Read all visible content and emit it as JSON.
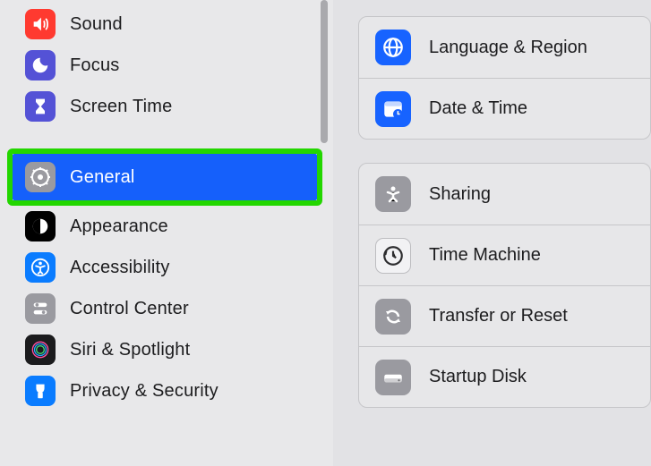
{
  "sidebar": {
    "items": [
      {
        "label": "Sound"
      },
      {
        "label": "Focus"
      },
      {
        "label": "Screen Time"
      },
      {
        "label": "General"
      },
      {
        "label": "Appearance"
      },
      {
        "label": "Accessibility"
      },
      {
        "label": "Control Center"
      },
      {
        "label": "Siri & Spotlight"
      },
      {
        "label": "Privacy & Security"
      }
    ]
  },
  "panel": {
    "group1": [
      {
        "label": "Language & Region"
      },
      {
        "label": "Date & Time"
      }
    ],
    "group2": [
      {
        "label": "Sharing"
      },
      {
        "label": "Time Machine"
      },
      {
        "label": "Transfer or Reset"
      },
      {
        "label": "Startup Disk"
      }
    ]
  },
  "colors": {
    "accent": "#1560fb",
    "highlight": "#23d600"
  }
}
